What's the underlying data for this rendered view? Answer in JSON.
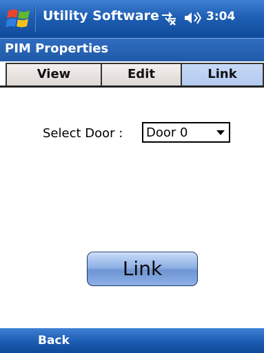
{
  "titlebar": {
    "app_title": "Utility Software",
    "time": "3:04"
  },
  "header": {
    "title": "PIM Properties"
  },
  "tabs": [
    {
      "label": "View",
      "active": false
    },
    {
      "label": "Edit",
      "active": false
    },
    {
      "label": "Link",
      "active": true
    }
  ],
  "form": {
    "select_label": "Select Door :",
    "selected_door": "Door 0"
  },
  "actions": {
    "link_label": "Link"
  },
  "softkeys": {
    "left": "Back"
  },
  "colors": {
    "bar_blue": "#1e5fb4",
    "active_tab": "#b9cff2",
    "inactive_tab": "#e6e0dc"
  }
}
